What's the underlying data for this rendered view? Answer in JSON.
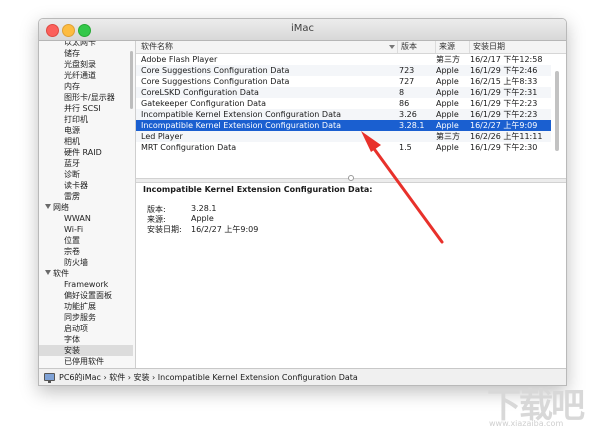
{
  "window": {
    "title": "iMac"
  },
  "sidebar": {
    "items": [
      {
        "label": "以太网卡",
        "indent": 2,
        "section": false,
        "selected": false
      },
      {
        "label": "储存",
        "indent": 2,
        "section": false,
        "selected": false
      },
      {
        "label": "光盘刻录",
        "indent": 2,
        "section": false,
        "selected": false
      },
      {
        "label": "光纤通道",
        "indent": 2,
        "section": false,
        "selected": false
      },
      {
        "label": "内存",
        "indent": 2,
        "section": false,
        "selected": false
      },
      {
        "label": "图形卡/显示器",
        "indent": 2,
        "section": false,
        "selected": false
      },
      {
        "label": "并行 SCSI",
        "indent": 2,
        "section": false,
        "selected": false
      },
      {
        "label": "打印机",
        "indent": 2,
        "section": false,
        "selected": false
      },
      {
        "label": "电源",
        "indent": 2,
        "section": false,
        "selected": false
      },
      {
        "label": "相机",
        "indent": 2,
        "section": false,
        "selected": false
      },
      {
        "label": "硬件 RAID",
        "indent": 2,
        "section": false,
        "selected": false
      },
      {
        "label": "蓝牙",
        "indent": 2,
        "section": false,
        "selected": false
      },
      {
        "label": "诊断",
        "indent": 2,
        "section": false,
        "selected": false
      },
      {
        "label": "读卡器",
        "indent": 2,
        "section": false,
        "selected": false
      },
      {
        "label": "雷雳",
        "indent": 2,
        "section": false,
        "selected": false
      },
      {
        "label": "网络",
        "indent": 1,
        "section": true,
        "selected": false
      },
      {
        "label": "WWAN",
        "indent": 2,
        "section": false,
        "selected": false
      },
      {
        "label": "Wi-Fi",
        "indent": 2,
        "section": false,
        "selected": false
      },
      {
        "label": "位置",
        "indent": 2,
        "section": false,
        "selected": false
      },
      {
        "label": "宗卷",
        "indent": 2,
        "section": false,
        "selected": false
      },
      {
        "label": "防火墙",
        "indent": 2,
        "section": false,
        "selected": false
      },
      {
        "label": "软件",
        "indent": 1,
        "section": true,
        "selected": false
      },
      {
        "label": "Framework",
        "indent": 2,
        "section": false,
        "selected": false
      },
      {
        "label": "偏好设置面板",
        "indent": 2,
        "section": false,
        "selected": false
      },
      {
        "label": "功能扩展",
        "indent": 2,
        "section": false,
        "selected": false
      },
      {
        "label": "同步服务",
        "indent": 2,
        "section": false,
        "selected": false
      },
      {
        "label": "启动项",
        "indent": 2,
        "section": false,
        "selected": false
      },
      {
        "label": "字体",
        "indent": 2,
        "section": false,
        "selected": false
      },
      {
        "label": "安装",
        "indent": 2,
        "section": false,
        "selected": true
      },
      {
        "label": "已停用软件",
        "indent": 2,
        "section": false,
        "selected": false
      }
    ]
  },
  "table": {
    "columns": [
      "软件名称",
      "版本",
      "来源",
      "安装日期"
    ],
    "rows": [
      {
        "name": "Adobe Flash Player",
        "version": "",
        "source": "第三方",
        "date": "16/2/17 下午12:58",
        "selected": false
      },
      {
        "name": "Core Suggestions Configuration Data",
        "version": "723",
        "source": "Apple",
        "date": "16/1/29 下午2:46",
        "selected": false
      },
      {
        "name": "Core Suggestions Configuration Data",
        "version": "727",
        "source": "Apple",
        "date": "16/2/15 上午8:33",
        "selected": false
      },
      {
        "name": "CoreLSKD Configuration Data",
        "version": "8",
        "source": "Apple",
        "date": "16/1/29 下午2:31",
        "selected": false
      },
      {
        "name": "Gatekeeper Configuration Data",
        "version": "86",
        "source": "Apple",
        "date": "16/1/29 下午2:23",
        "selected": false
      },
      {
        "name": "Incompatible Kernel Extension Configuration Data",
        "version": "3.26",
        "source": "Apple",
        "date": "16/1/29 下午2:23",
        "selected": false
      },
      {
        "name": "Incompatible Kernel Extension Configuration Data",
        "version": "3.28.1",
        "source": "Apple",
        "date": "16/2/27 上午9:09",
        "selected": true
      },
      {
        "name": "Led Player",
        "version": "",
        "source": "第三方",
        "date": "16/2/26 上午11:11",
        "selected": false
      },
      {
        "name": "MRT Configuration Data",
        "version": "1.5",
        "source": "Apple",
        "date": "16/1/29 下午2:30",
        "selected": false
      }
    ]
  },
  "detail": {
    "title": "Incompatible Kernel Extension Configuration Data:",
    "fields": [
      {
        "label": "版本:",
        "value": "3.28.1"
      },
      {
        "label": "来源:",
        "value": "Apple"
      },
      {
        "label": "安装日期:",
        "value": "16/2/27 上午9:09"
      }
    ]
  },
  "pathbar": {
    "text": "PC6的iMac › 软件 › 安装 › Incompatible Kernel Extension Configuration Data"
  },
  "watermark": {
    "text": "下载吧",
    "url": "www.xiazaiba.com"
  },
  "colors": {
    "selection": "#1a5fd0",
    "arrow": "#e8312b"
  },
  "icons": {
    "pathbar": "imac-icon",
    "disclosure": "disclosure-triangle-icon"
  }
}
